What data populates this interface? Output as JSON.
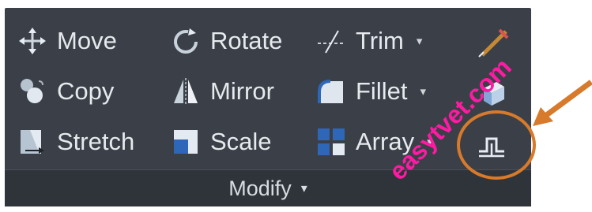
{
  "panel": {
    "name": "Modify",
    "tools": {
      "move": "Move",
      "rotate": "Rotate",
      "trim": "Trim",
      "copy": "Copy",
      "mirror": "Mirror",
      "fillet": "Fillet",
      "stretch": "Stretch",
      "scale": "Scale",
      "array": "Array"
    },
    "dropdown_glyph": "▾"
  },
  "watermark": "easytvet.com",
  "colors": {
    "panel_bg": "#3b4048",
    "footer_bg": "#2f343b",
    "text": "#e6e9ed",
    "highlight": "#d77a2b",
    "watermark": "#ff1aa3"
  },
  "icons": [
    "move-icon",
    "rotate-icon",
    "trim-icon",
    "copy-icon",
    "mirror-icon",
    "fillet-icon",
    "stretch-icon",
    "scale-icon",
    "array-icon",
    "edit-brush-icon",
    "blend-icon",
    "offset-icon"
  ]
}
